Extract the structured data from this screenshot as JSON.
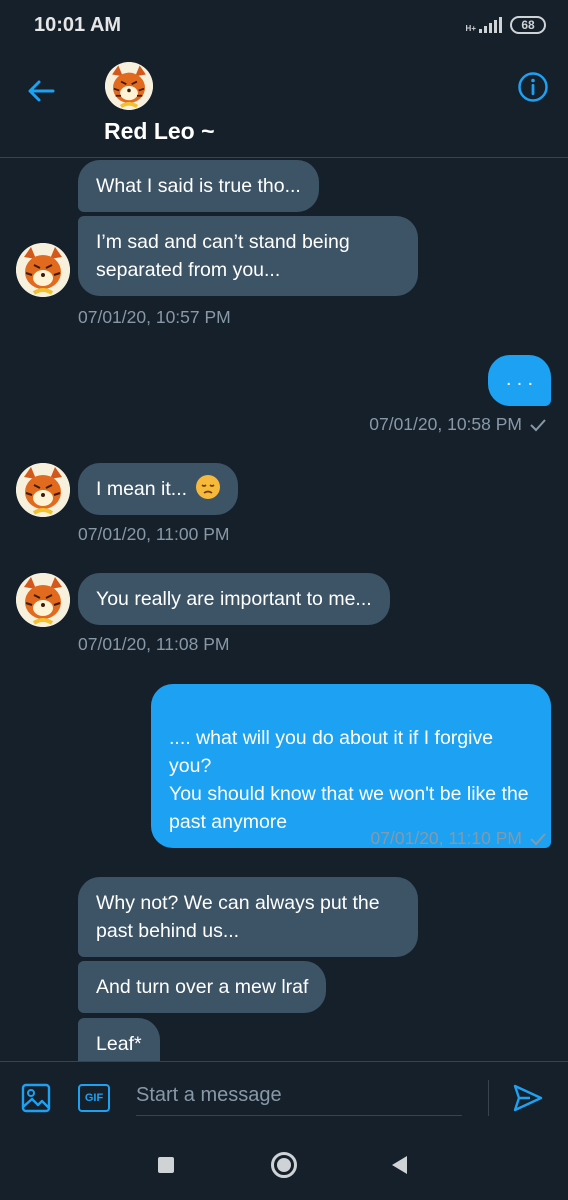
{
  "status_bar": {
    "time": "10:01 AM",
    "network": "H+",
    "battery": "68"
  },
  "header": {
    "contact_name": "Red Leo ~"
  },
  "messages": [
    {
      "text": "What I said is true tho..."
    },
    {
      "text": "I’m sad and can’t stand being separated from you..."
    },
    {
      "timestamp": "07/01/20, 10:57 PM"
    },
    {
      "text": ". . ."
    },
    {
      "timestamp": "07/01/20, 10:58 PM"
    },
    {
      "text": "I mean it...",
      "emoji": "disappointed-face-emoji"
    },
    {
      "timestamp": "07/01/20, 11:00 PM"
    },
    {
      "text": "You really are important to me..."
    },
    {
      "timestamp": "07/01/20, 11:08 PM"
    },
    {
      "text": ".... what will you do about it if I forgive you?\nYou should know that we won't be like the past anymore"
    },
    {
      "timestamp": "07/01/20, 11:10 PM"
    },
    {
      "text": "Why not? We can always put the past behind us..."
    },
    {
      "text": "And turn over a mew lraf"
    },
    {
      "text": "Leaf*"
    }
  ],
  "composer": {
    "placeholder": "Start a message",
    "gif_label": "GIF"
  },
  "colors": {
    "background": "#15202b",
    "incoming_bubble": "#3d5466",
    "outgoing_bubble": "#1da1f2",
    "accent": "#1da1f2",
    "muted_text": "#8899a6"
  }
}
